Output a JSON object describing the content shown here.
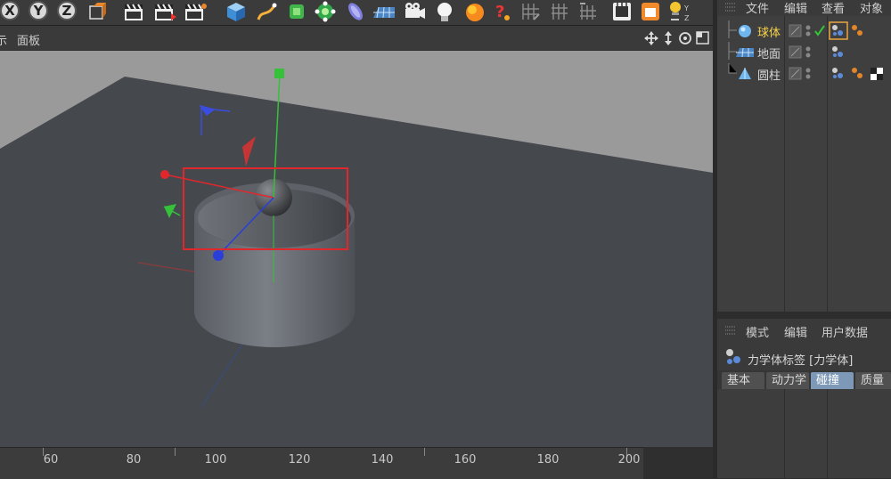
{
  "axis_buttons": [
    "X",
    "Y",
    "Z"
  ],
  "menubar": {
    "left_fragment": "示",
    "panel": "面板"
  },
  "viewport": {
    "selection_box_color": "#e0282c",
    "axis_colors": {
      "x": "#e0282c",
      "y": "#35c23a",
      "z": "#2a3fd9"
    }
  },
  "ruler": {
    "ticks": [
      "60",
      "80",
      "100",
      "120",
      "140",
      "160",
      "180",
      "200"
    ]
  },
  "object_manager": {
    "menu": [
      "文件",
      "编辑",
      "查看",
      "对象"
    ],
    "objects": [
      {
        "name": "球体",
        "icon": "sphere-icon",
        "selected": true
      },
      {
        "name": "地面",
        "icon": "floor-icon",
        "selected": false
      },
      {
        "name": "圆柱",
        "icon": "cylinder-icon",
        "selected": false
      }
    ]
  },
  "attribute_manager": {
    "menu": [
      "模式",
      "编辑",
      "用户数据"
    ],
    "title": "力学体标签 [力学体]",
    "tabs": [
      "基本",
      "动力学",
      "碰撞",
      "质量"
    ],
    "active_tab": "碰撞"
  }
}
